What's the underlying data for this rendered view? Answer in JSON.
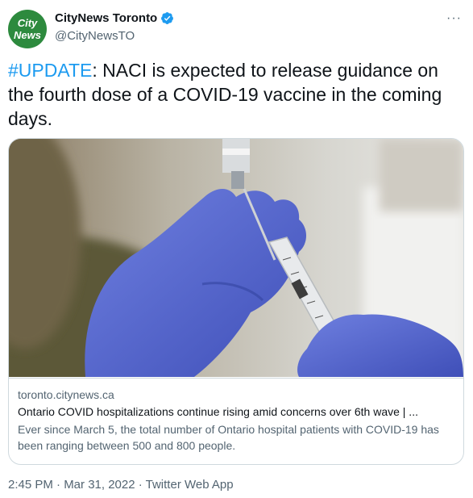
{
  "account": {
    "avatar_line1": "City",
    "avatar_line2": "News",
    "display_name": "CityNews Toronto",
    "handle": "@CityNewsTO",
    "avatar_color": "#2d8a3e",
    "verified_color": "#1d9bf0"
  },
  "more_label": "···",
  "tweet": {
    "hashtag": "#UPDATE",
    "text": ": NACI is expected to release guidance on the fourth dose of a COVID-19 vaccine in the coming days."
  },
  "card": {
    "domain": "toronto.citynews.ca",
    "title": "Ontario COVID hospitalizations continue rising amid concerns over 6th wave | ...",
    "description": "Ever since March 5, the total number of Ontario hospital patients with COVID-19 has been ranging between 500 and 800 people."
  },
  "meta": "2:45 PM · Mar 31, 2022 · Twitter Web App",
  "colors": {
    "link": "#1d9bf0",
    "secondary_text": "#536471",
    "border": "#cfd9de"
  }
}
